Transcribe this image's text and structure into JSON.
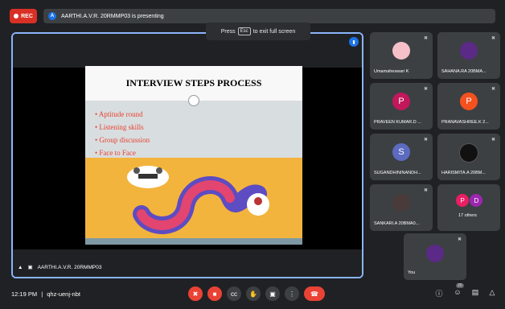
{
  "recording": {
    "label": "REC"
  },
  "presenting_banner": {
    "avatar_letter": "A",
    "text": "AARTHI.A.V.R. 20RMMP03 is presenting"
  },
  "fullscreen_hint": {
    "prefix": "Press",
    "key": "Esc",
    "suffix": "to exit full screen"
  },
  "presentation": {
    "presenter_label": "AARTHI.A.V.R. 20RMMP03",
    "slide": {
      "title": "INTERVIEW STEPS PROCESS",
      "bullets": [
        "Aptitude round",
        "Listening skills",
        "Group discussion",
        "Face to Face"
      ]
    }
  },
  "participants": [
    {
      "name": "Umamaheswari K",
      "avatar_letter": "",
      "avatar_color": "#f5c0c8"
    },
    {
      "name": "SAHANA.RA 20BMA...",
      "avatar_letter": "",
      "avatar_color": "#5b2a86"
    },
    {
      "name": "PRAVEEN KUMAR.D ...",
      "avatar_letter": "P",
      "avatar_color": "#c2185b"
    },
    {
      "name": "PRANAVASHREE.K 2...",
      "avatar_letter": "P",
      "avatar_color": "#f4511e"
    },
    {
      "name": "SUGANDHININANDH...",
      "avatar_letter": "S",
      "avatar_color": "#5c6bc0"
    },
    {
      "name": "HARISMITA.A 20BM...",
      "avatar_letter": "",
      "avatar_color": "#111111"
    },
    {
      "name": "SANKARI.A 20BMA0...",
      "avatar_letter": "",
      "avatar_color": "#4a3b3b"
    },
    {
      "name": "17 others",
      "avatar_letter": "P",
      "avatar_color": "#e91e63",
      "second_letter": "D",
      "second_color": "#9c27b0"
    }
  ],
  "self_tile": {
    "name": "You",
    "avatar_color": "#5b2a86"
  },
  "meeting_info": {
    "time": "12:19 PM",
    "separator": "|",
    "code": "qhz-uenj-nbt"
  },
  "people_badge": "20",
  "colors": {
    "accent": "#8ab4f8",
    "danger": "#ea4335",
    "background": "#202124",
    "tile": "#3c4043"
  }
}
